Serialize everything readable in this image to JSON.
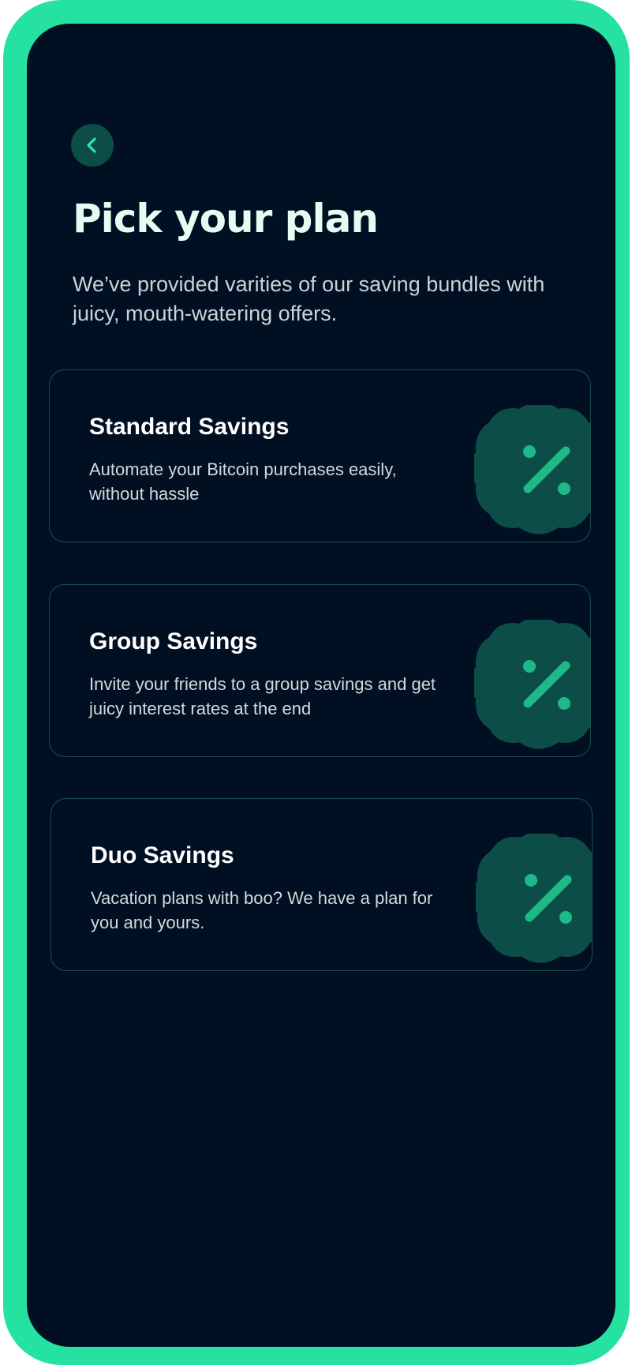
{
  "screen": {
    "title": "Pick your plan",
    "subtitle": "We’ve provided varities of our saving bundles with juicy, mouth-watering offers."
  },
  "back_button": {
    "icon": "chevron-left-icon"
  },
  "plans": [
    {
      "title": "Standard Savings",
      "description": "Automate your Bitcoin purchases easily, without hassle",
      "icon": "percent-badge-icon"
    },
    {
      "title": "Group Savings",
      "description": "Invite your friends to a group savings and get juicy interest rates at the end",
      "icon": "percent-badge-icon"
    },
    {
      "title": "Duo Savings",
      "description": "Vacation plans with boo? We have a plan for you and yours.",
      "icon": "percent-badge-icon"
    }
  ],
  "colors": {
    "frame": "#25e2a1",
    "background": "#010f23",
    "accent": "#1db989",
    "badge": "#0d4d48"
  }
}
